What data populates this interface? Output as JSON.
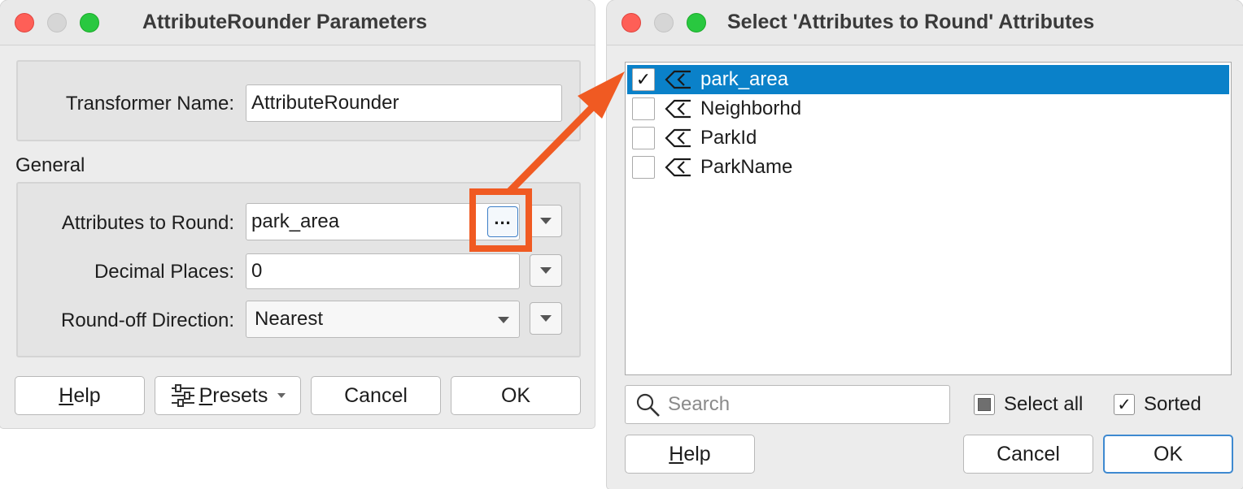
{
  "left_dialog": {
    "title": "AttributeRounder Parameters",
    "transformer_name_label": "Transformer Name:",
    "transformer_name_value": "AttributeRounder",
    "section_general": "General",
    "attributes_label": "Attributes to Round:",
    "attributes_value": "park_area",
    "ellipsis_label": "...",
    "decimal_label": "Decimal Places:",
    "decimal_value": "0",
    "direction_label": "Round-off Direction:",
    "direction_value": "Nearest",
    "buttons": {
      "help_first": "H",
      "help_rest": "elp",
      "presets_first": "P",
      "presets_rest": "resets",
      "cancel": "Cancel",
      "ok": "OK"
    }
  },
  "right_dialog": {
    "title": "Select 'Attributes to Round' Attributes",
    "attributes": [
      {
        "name": "park_area",
        "checked": true,
        "selected": true
      },
      {
        "name": "Neighborhd",
        "checked": false,
        "selected": false
      },
      {
        "name": "ParkId",
        "checked": false,
        "selected": false
      },
      {
        "name": "ParkName",
        "checked": false,
        "selected": false
      }
    ],
    "search_placeholder": "Search",
    "select_all_label": "Select all",
    "sorted_label": "Sorted",
    "buttons": {
      "help_first": "H",
      "help_rest": "elp",
      "cancel": "Cancel",
      "ok": "OK"
    }
  },
  "annotation": {
    "highlight_color": "#f05a22",
    "arrow_color": "#f05a22"
  },
  "icons": {
    "attribute_icon": "attribute-tag-icon",
    "search_icon": "search-icon",
    "presets_icon": "sliders-icon"
  }
}
